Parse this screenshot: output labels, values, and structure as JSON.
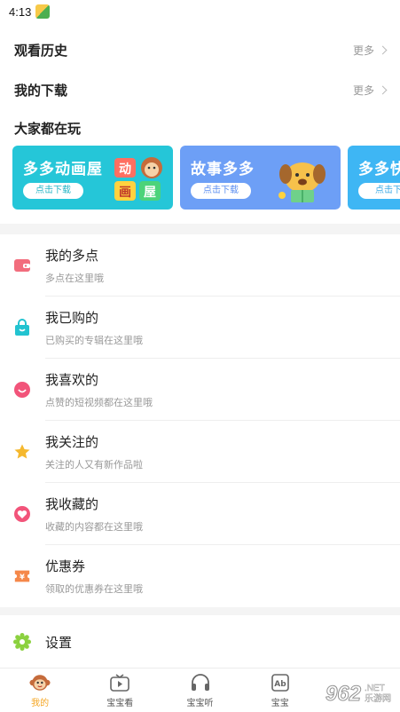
{
  "status": {
    "time": "4:13"
  },
  "history": {
    "title": "观看历史",
    "more": "更多"
  },
  "downloads": {
    "title": "我的下载",
    "more": "更多"
  },
  "playing": {
    "title": "大家都在玩",
    "banners": [
      {
        "title": "多多动画屋",
        "button": "点击下载",
        "art_text": "动画屋"
      },
      {
        "title": "故事多多",
        "button": "点击下载"
      },
      {
        "title": "多多快",
        "button": "点击下"
      }
    ]
  },
  "menu": [
    {
      "title": "我的多点",
      "sub": "多点在这里哦",
      "icon": "wallet-icon",
      "color": "#f26d7d"
    },
    {
      "title": "我已购的",
      "sub": "已购买的专辑在这里哦",
      "icon": "shopping-bag-icon",
      "color": "#22c3d0"
    },
    {
      "title": "我喜欢的",
      "sub": "点赞的短视频都在这里哦",
      "icon": "smile-icon",
      "color": "#f2547a"
    },
    {
      "title": "我关注的",
      "sub": "关注的人又有新作品啦",
      "icon": "star-icon",
      "color": "#f5b82e"
    },
    {
      "title": "我收藏的",
      "sub": "收藏的内容都在这里哦",
      "icon": "heart-icon",
      "color": "#f2547a"
    },
    {
      "title": "优惠券",
      "sub": "领取的优惠券在这里哦",
      "icon": "coupon-icon",
      "color": "#f5884a"
    }
  ],
  "settings": {
    "title": "设置",
    "icon": "gear-icon",
    "color": "#8bd13f"
  },
  "tabs": [
    {
      "label": "我的",
      "icon": "monkey-icon",
      "active": true
    },
    {
      "label": "宝宝看",
      "icon": "tv-icon"
    },
    {
      "label": "宝宝听",
      "icon": "headphones-icon"
    },
    {
      "label": "宝宝",
      "icon": "abc-icon"
    },
    {
      "label": "",
      "icon": "more-icon"
    }
  ],
  "watermark": {
    "number": "962",
    "net": ".NET",
    "cn": "乐游网"
  }
}
